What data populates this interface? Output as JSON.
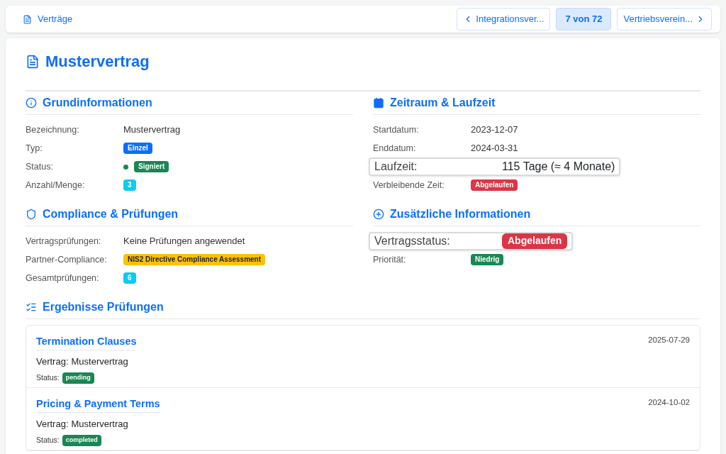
{
  "breadcrumb": "Verträge",
  "nav": {
    "prev": "Integrationsver...",
    "position": "7 von 72",
    "next": "Vertriebsverein..."
  },
  "title": "Mustervertrag",
  "columns": [
    [
      {
        "heading": "Grundinformationen",
        "rows": [
          {
            "label": "Bezeichnung:",
            "kind": "text",
            "value": "Mustervertrag",
            "highlighted": false
          },
          {
            "label": "Typ:",
            "kind": "badge",
            "value": "Einzel",
            "color": "#0d6efd",
            "highlighted": false
          },
          {
            "label": "Status:",
            "kind": "dot_badge",
            "value": "Signiert",
            "color": "#198754",
            "highlighted": false
          },
          {
            "label": "Anzahl/Menge:",
            "kind": "badge",
            "value": "3",
            "color": "#0dcaf0",
            "highlighted": false
          }
        ]
      },
      {
        "heading": "Compliance & Prüfungen",
        "rows": [
          {
            "label": "Vertragsprüfungen:",
            "kind": "text",
            "value": "Keine Prüfungen angewendet",
            "highlighted": false
          },
          {
            "label": "Partner-Compliance:",
            "kind": "badge",
            "value": "NIS2 Directive Compliance Assessment",
            "color": "#ffc107",
            "highlighted": false
          },
          {
            "label": "Gesamtprüfungen:",
            "kind": "badge",
            "value": "6",
            "color": "#0dcaf0",
            "highlighted": false
          }
        ]
      }
    ],
    [
      {
        "heading": "Zeitraum & Laufzeit",
        "rows": [
          {
            "label": "Startdatum:",
            "kind": "text",
            "value": "2023-12-07",
            "highlighted": false
          },
          {
            "label": "Enddatum:",
            "kind": "text",
            "value": "2024-03-31",
            "highlighted": false
          },
          {
            "label": "Laufzeit:",
            "kind": "text",
            "value": "115 Tage (≈ 4 Monate)",
            "highlighted": true
          },
          {
            "label": "Verbleibende Zeit:",
            "kind": "badge",
            "value": "Abgelaufen",
            "color": "#dc3545",
            "highlighted": false
          }
        ]
      },
      {
        "heading": "Zusätzliche Informationen",
        "rows": [
          {
            "label": "Vertragsstatus:",
            "kind": "badge",
            "value": "Abgelaufen",
            "color": "#dc3545",
            "highlighted": true
          },
          {
            "label": "Priorität:",
            "kind": "badge",
            "value": "Niedrig",
            "color": "#198754",
            "highlighted": false
          }
        ]
      }
    ]
  ],
  "results": {
    "heading": "Ergebnisse Prüfungen",
    "items": [
      {
        "title": "Termination Clauses",
        "date": "2025-07-29",
        "contract_label": "Vertrag:",
        "contract": "Mustervertrag",
        "status_label": "Status:",
        "status": "pending"
      },
      {
        "title": "Pricing & Payment Terms",
        "date": "2024-10-02",
        "contract_label": "Vertrag:",
        "contract": "Mustervertrag",
        "status_label": "Status:",
        "status": "completed"
      }
    ]
  }
}
